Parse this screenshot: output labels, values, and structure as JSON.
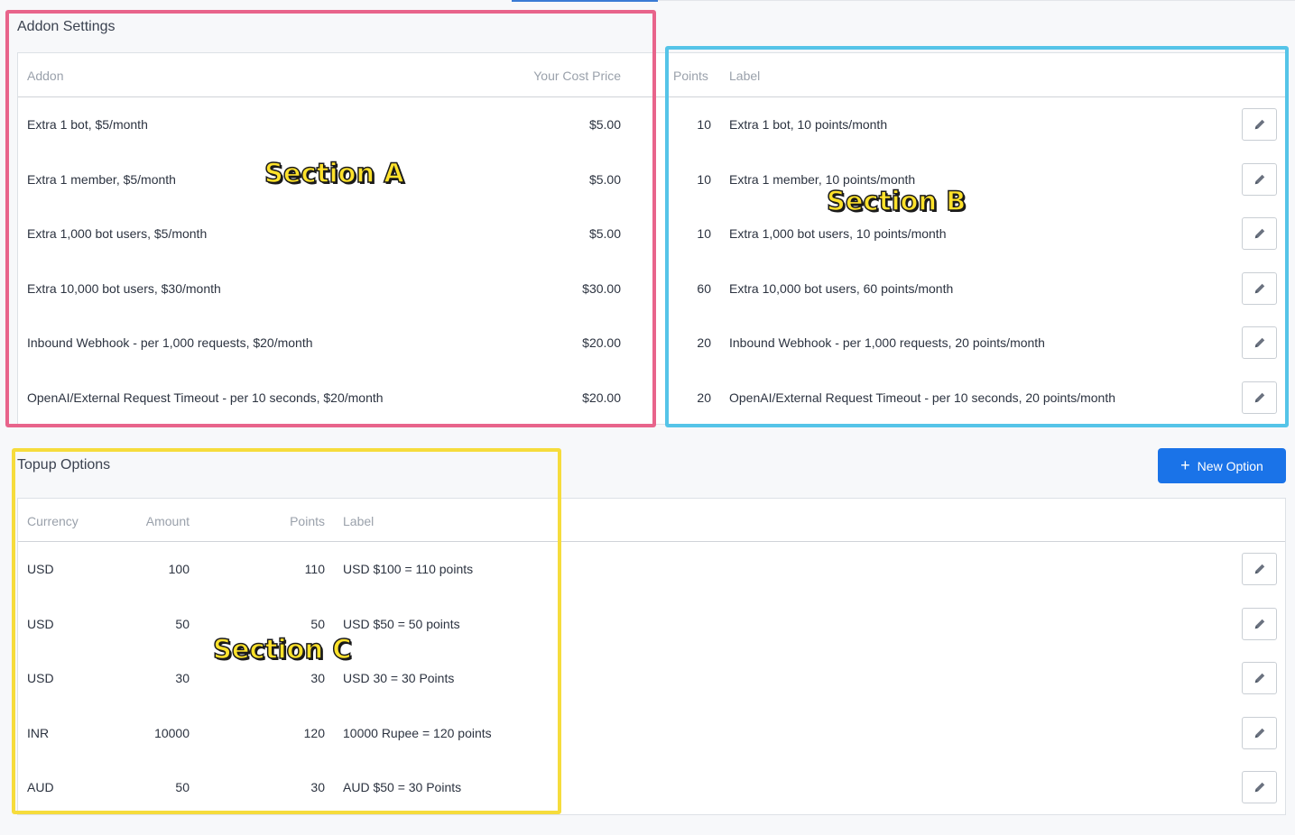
{
  "addon_settings": {
    "title": "Addon Settings",
    "columns": {
      "addon": "Addon",
      "cost": "Your Cost Price",
      "points": "Points",
      "label": "Label"
    },
    "rows": [
      {
        "addon": "Extra 1 bot, $5/month",
        "cost": "$5.00",
        "points": "10",
        "label": "Extra 1 bot, 10 points/month"
      },
      {
        "addon": "Extra 1 member, $5/month",
        "cost": "$5.00",
        "points": "10",
        "label": "Extra 1 member, 10 points/month"
      },
      {
        "addon": "Extra 1,000 bot users, $5/month",
        "cost": "$5.00",
        "points": "10",
        "label": "Extra 1,000 bot users, 10 points/month"
      },
      {
        "addon": "Extra 10,000 bot users, $30/month",
        "cost": "$30.00",
        "points": "60",
        "label": "Extra 10,000 bot users, 60 points/month"
      },
      {
        "addon": "Inbound Webhook - per 1,000 requests, $20/month",
        "cost": "$20.00",
        "points": "20",
        "label": "Inbound Webhook - per 1,000 requests, 20 points/month"
      },
      {
        "addon": "OpenAI/External Request Timeout - per 10 seconds, $20/month",
        "cost": "$20.00",
        "points": "20",
        "label": "OpenAI/External Request Timeout - per 10 seconds, 20 points/month"
      }
    ]
  },
  "topup_options": {
    "title": "Topup Options",
    "new_option_label": "New Option",
    "columns": {
      "currency": "Currency",
      "amount": "Amount",
      "points": "Points",
      "label": "Label"
    },
    "rows": [
      {
        "currency": "USD",
        "amount": "100",
        "points": "110",
        "label": "USD $100 = 110 points"
      },
      {
        "currency": "USD",
        "amount": "50",
        "points": "50",
        "label": "USD $50 = 50 points"
      },
      {
        "currency": "USD",
        "amount": "30",
        "points": "30",
        "label": "USD 30 = 30 Points"
      },
      {
        "currency": "INR",
        "amount": "10000",
        "points": "120",
        "label": "10000 Rupee = 120 points"
      },
      {
        "currency": "AUD",
        "amount": "50",
        "points": "30",
        "label": "AUD $50 = 30 Points"
      }
    ]
  },
  "annotations": {
    "section_a": "Section A",
    "section_b": "Section B",
    "section_c": "Section C",
    "colors": {
      "a": "#e8648b",
      "b": "#55c4e8",
      "c": "#f6dc3c"
    }
  },
  "icons": {
    "edit": "pencil-icon",
    "add": "plus-icon"
  },
  "colors": {
    "primary": "#1a73e8",
    "header_text": "#9aa1ab"
  }
}
